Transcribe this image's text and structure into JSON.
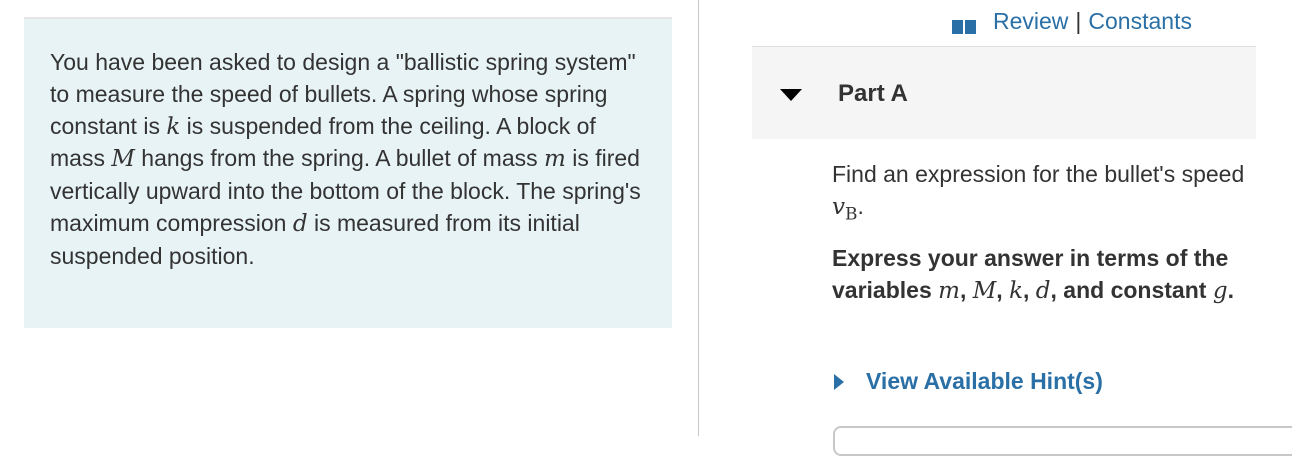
{
  "problem": {
    "s1": "You have been asked to design a \"ballistic spring system\" to measure the speed of bullets. A spring whose spring constant is ",
    "var_k": "k",
    "s2": " is suspended from the ceiling. A block of mass ",
    "var_M": "M",
    "s3": " hangs from the spring. A bullet of mass ",
    "var_m": "m",
    "s4": " is fired vertically upward into the bottom of the block. The spring's maximum compression ",
    "var_d": "d",
    "s5": " is measured from its initial suspended position."
  },
  "header": {
    "review": "Review",
    "separator": "|",
    "constants": "Constants",
    "book_icon": "book-icon"
  },
  "part": {
    "title": "Part A",
    "question_text": "Find an expression for the bullet's speed ",
    "question_var": "v",
    "question_sub": "B",
    "question_end": ".",
    "instruct_text": "Express your answer in terms of the variables ",
    "v_m": "m",
    "c1": ", ",
    "v_M": "M",
    "c2": ", ",
    "v_k": "k",
    "c3": ", ",
    "v_d": "d",
    "and_text": ", and constant ",
    "v_g": "g",
    "end": "."
  },
  "hints": {
    "label": "View Available Hint(s)"
  },
  "colors": {
    "link": "#2a70a6",
    "panel_bg": "#e8f3f6",
    "part_header_bg": "#f5f5f5"
  }
}
